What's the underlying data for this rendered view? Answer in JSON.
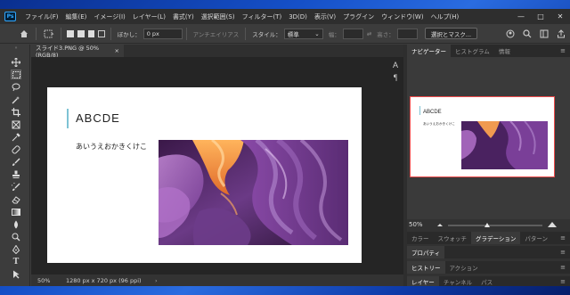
{
  "menubar": {
    "logo": "Ps",
    "items": [
      "ファイル(F)",
      "編集(E)",
      "イメージ(I)",
      "レイヤー(L)",
      "書式(Y)",
      "選択範囲(S)",
      "フィルター(T)",
      "3D(D)",
      "表示(V)",
      "プラグイン",
      "ウィンドウ(W)",
      "ヘルプ(H)"
    ],
    "window_controls": [
      "—",
      "□",
      "✕"
    ]
  },
  "options": {
    "feather_label": "ぼかし：",
    "feather_value": "0 px",
    "antialias_label": "アンチエイリアス",
    "style_label": "スタイル：",
    "style_value": "標準",
    "width_label": "幅：",
    "height_label": "高さ：",
    "select_mask_button": "選択とマスク..."
  },
  "document": {
    "tab_title": "スライド3.PNG @ 50% (RGB/8)",
    "tab_close": "×",
    "slide_title": "ABCDE",
    "slide_text": "あいうえおかきくけこ",
    "status_zoom": "50%",
    "status_info": "1280 px x 720 px (96 ppi)",
    "status_arrow": "›"
  },
  "panels": {
    "top_tabs": [
      "ナビゲーター",
      "ヒストグラム",
      "情報"
    ],
    "nav_zoom": "50%",
    "row2_tabs": [
      "カラー",
      "スウォッチ",
      "グラデーション",
      "パターン"
    ],
    "row3_tabs": [
      "プロパティ"
    ],
    "row4_tabs": [
      "ヒストリー",
      "アクション"
    ],
    "row5_tabs": [
      "レイヤー",
      "チャンネル",
      "パス"
    ],
    "menu_glyph": "≡"
  },
  "colors": {
    "accent_bar": "#7ec3d4",
    "navigator_frame": "#f04b4b",
    "ps_blue": "#31a8ff"
  }
}
